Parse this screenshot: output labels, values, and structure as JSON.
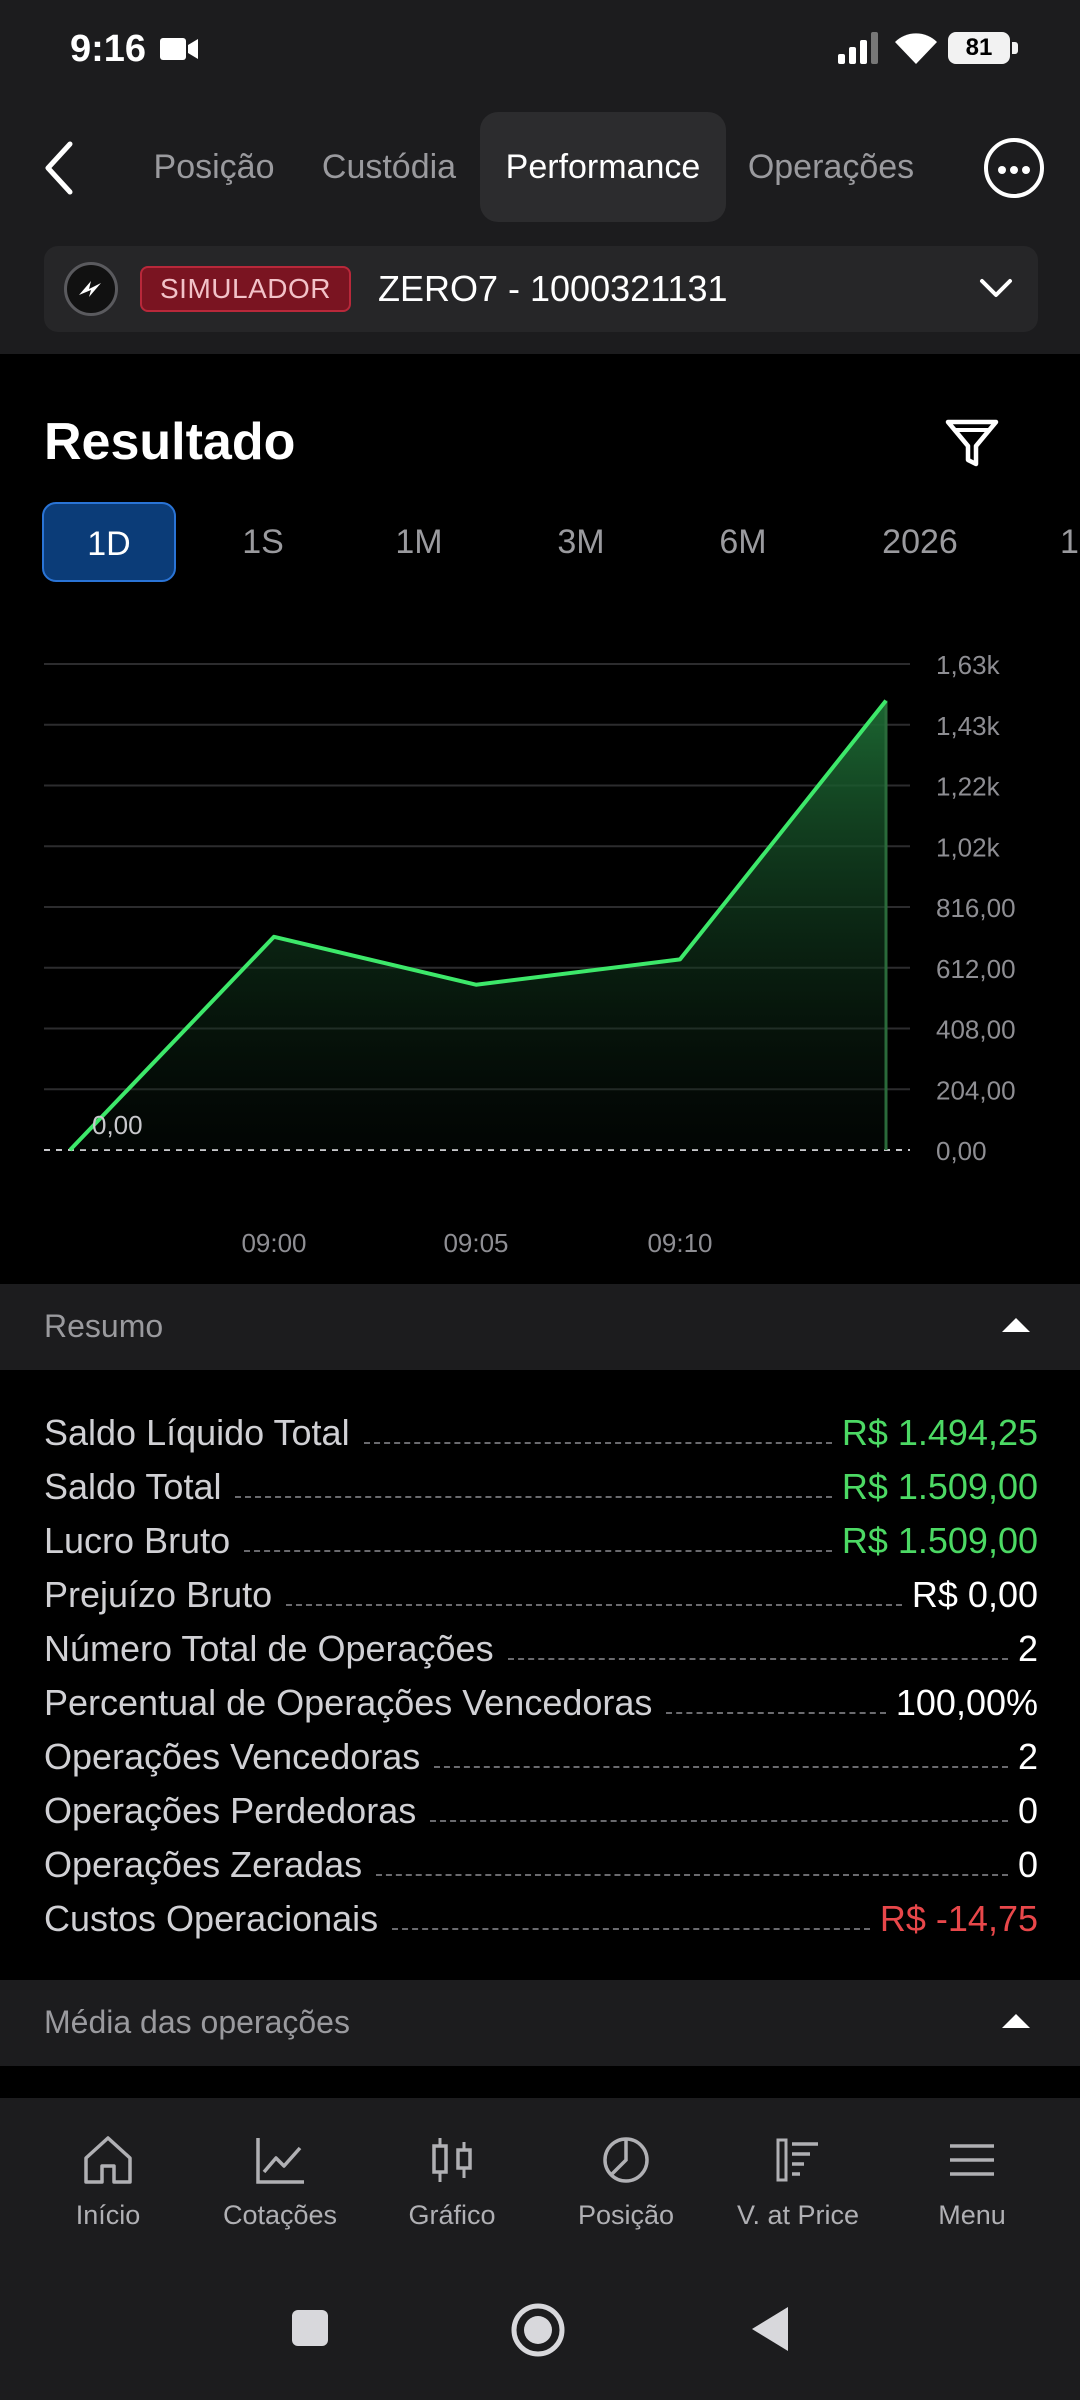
{
  "status_bar": {
    "time": "9:16",
    "battery": "81"
  },
  "tabs": [
    {
      "label": "Posição",
      "active": false
    },
    {
      "label": "Custódia",
      "active": false
    },
    {
      "label": "Performance",
      "active": true
    },
    {
      "label": "Operações",
      "active": false
    }
  ],
  "account": {
    "badge": "SIMULADOR",
    "name": "ZERO7 - 1000321131"
  },
  "result": {
    "title": "Resultado",
    "periods": [
      "1D",
      "1S",
      "1M",
      "3M",
      "6M",
      "2026",
      "1"
    ],
    "selected_period": "1D"
  },
  "chart_data": {
    "type": "area",
    "x": [
      "08:54",
      "09:00",
      "09:05",
      "09:10",
      "09:15"
    ],
    "values": [
      0,
      716,
      555,
      640,
      1509
    ],
    "ylim": [
      0,
      1632
    ],
    "yticks": [
      "1,63k",
      "1,43k",
      "1,22k",
      "1,02k",
      "816,00",
      "612,00",
      "408,00",
      "204,00",
      "0,00"
    ],
    "xticks": [
      "09:00",
      "09:05",
      "09:10"
    ],
    "start_label": "0,00",
    "line_color": "#3de86a",
    "fill_color": "#1d6b34"
  },
  "summary": {
    "header": "Resumo",
    "rows": [
      {
        "label": "Saldo Líquido Total",
        "value": "R$ 1.494,25",
        "tone": "green"
      },
      {
        "label": "Saldo Total",
        "value": "R$ 1.509,00",
        "tone": "green"
      },
      {
        "label": "Lucro Bruto",
        "value": "R$ 1.509,00",
        "tone": "green"
      },
      {
        "label": "Prejuízo Bruto",
        "value": "R$ 0,00",
        "tone": "white"
      },
      {
        "label": "Número Total de Operações",
        "value": "2",
        "tone": "white"
      },
      {
        "label": "Percentual de Operações Vencedoras",
        "value": "100,00%",
        "tone": "white"
      },
      {
        "label": "Operações Vencedoras",
        "value": "2",
        "tone": "white"
      },
      {
        "label": "Operações Perdedoras",
        "value": "0",
        "tone": "white"
      },
      {
        "label": "Operações Zeradas",
        "value": "0",
        "tone": "white"
      },
      {
        "label": "Custos Operacionais",
        "value": "R$ -14,75",
        "tone": "red"
      }
    ]
  },
  "average_section": {
    "header": "Média das operações"
  },
  "bottom_nav": [
    {
      "label": "Início",
      "icon": "home-icon"
    },
    {
      "label": "Cotações",
      "icon": "trend-icon"
    },
    {
      "label": "Gráfico",
      "icon": "candles-icon"
    },
    {
      "label": "Posição",
      "icon": "pie-icon"
    },
    {
      "label": "V. at Price",
      "icon": "volume-price-icon"
    },
    {
      "label": "Menu",
      "icon": "menu-icon"
    }
  ],
  "colors": {
    "green": "#4cd964",
    "red": "#e8474a",
    "accent": "#0b3c78"
  }
}
